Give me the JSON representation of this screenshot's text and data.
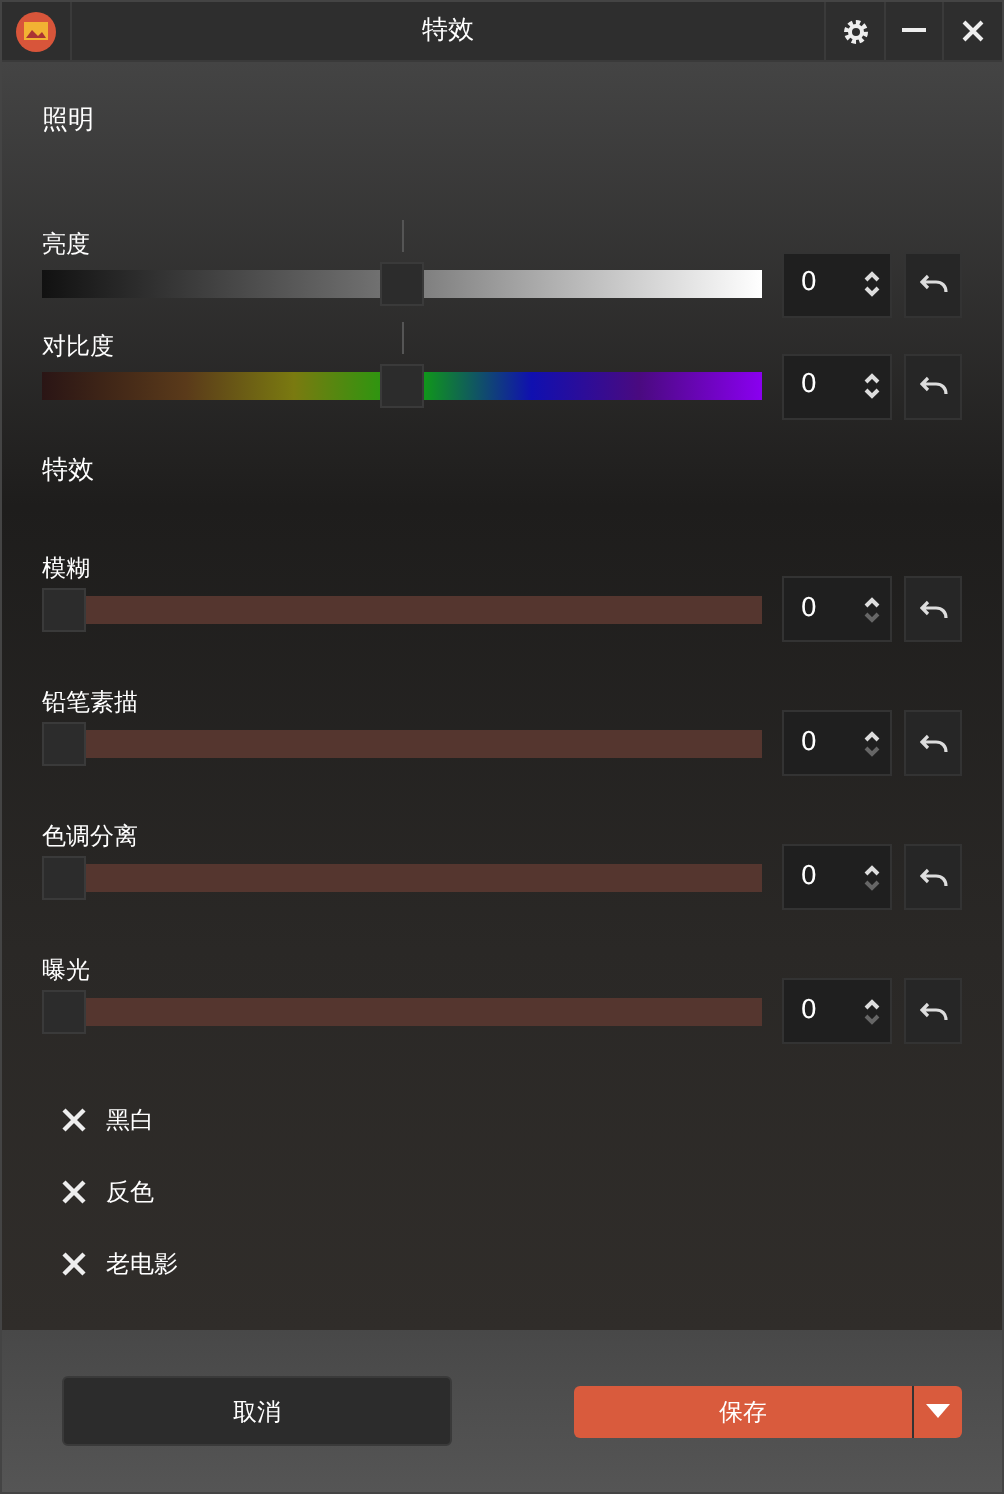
{
  "window": {
    "title": "特效"
  },
  "lighting": {
    "heading": "照明",
    "sliders": [
      {
        "label": "亮度",
        "kind": "grayscale",
        "level": 0.5,
        "value": "0",
        "at_min": false
      },
      {
        "label": "对比度",
        "kind": "spectrum",
        "level": 0.5,
        "value": "0",
        "at_min": false
      }
    ]
  },
  "effects": {
    "heading": "特效",
    "sliders": [
      {
        "label": "模糊",
        "kind": "effect",
        "level": 0,
        "value": "0",
        "at_min": true
      },
      {
        "label": "铅笔素描",
        "kind": "effect",
        "level": 0,
        "value": "0",
        "at_min": true
      },
      {
        "label": "色调分离",
        "kind": "effect",
        "level": 0,
        "value": "0",
        "at_min": true
      },
      {
        "label": "曝光",
        "kind": "effect",
        "level": 0,
        "value": "0",
        "at_min": true
      }
    ],
    "toggles": [
      {
        "label": "黑白",
        "checked": false
      },
      {
        "label": "反色",
        "checked": false
      },
      {
        "label": "老电影",
        "checked": false
      }
    ]
  },
  "footer": {
    "cancel": "取消",
    "save": "保存"
  }
}
